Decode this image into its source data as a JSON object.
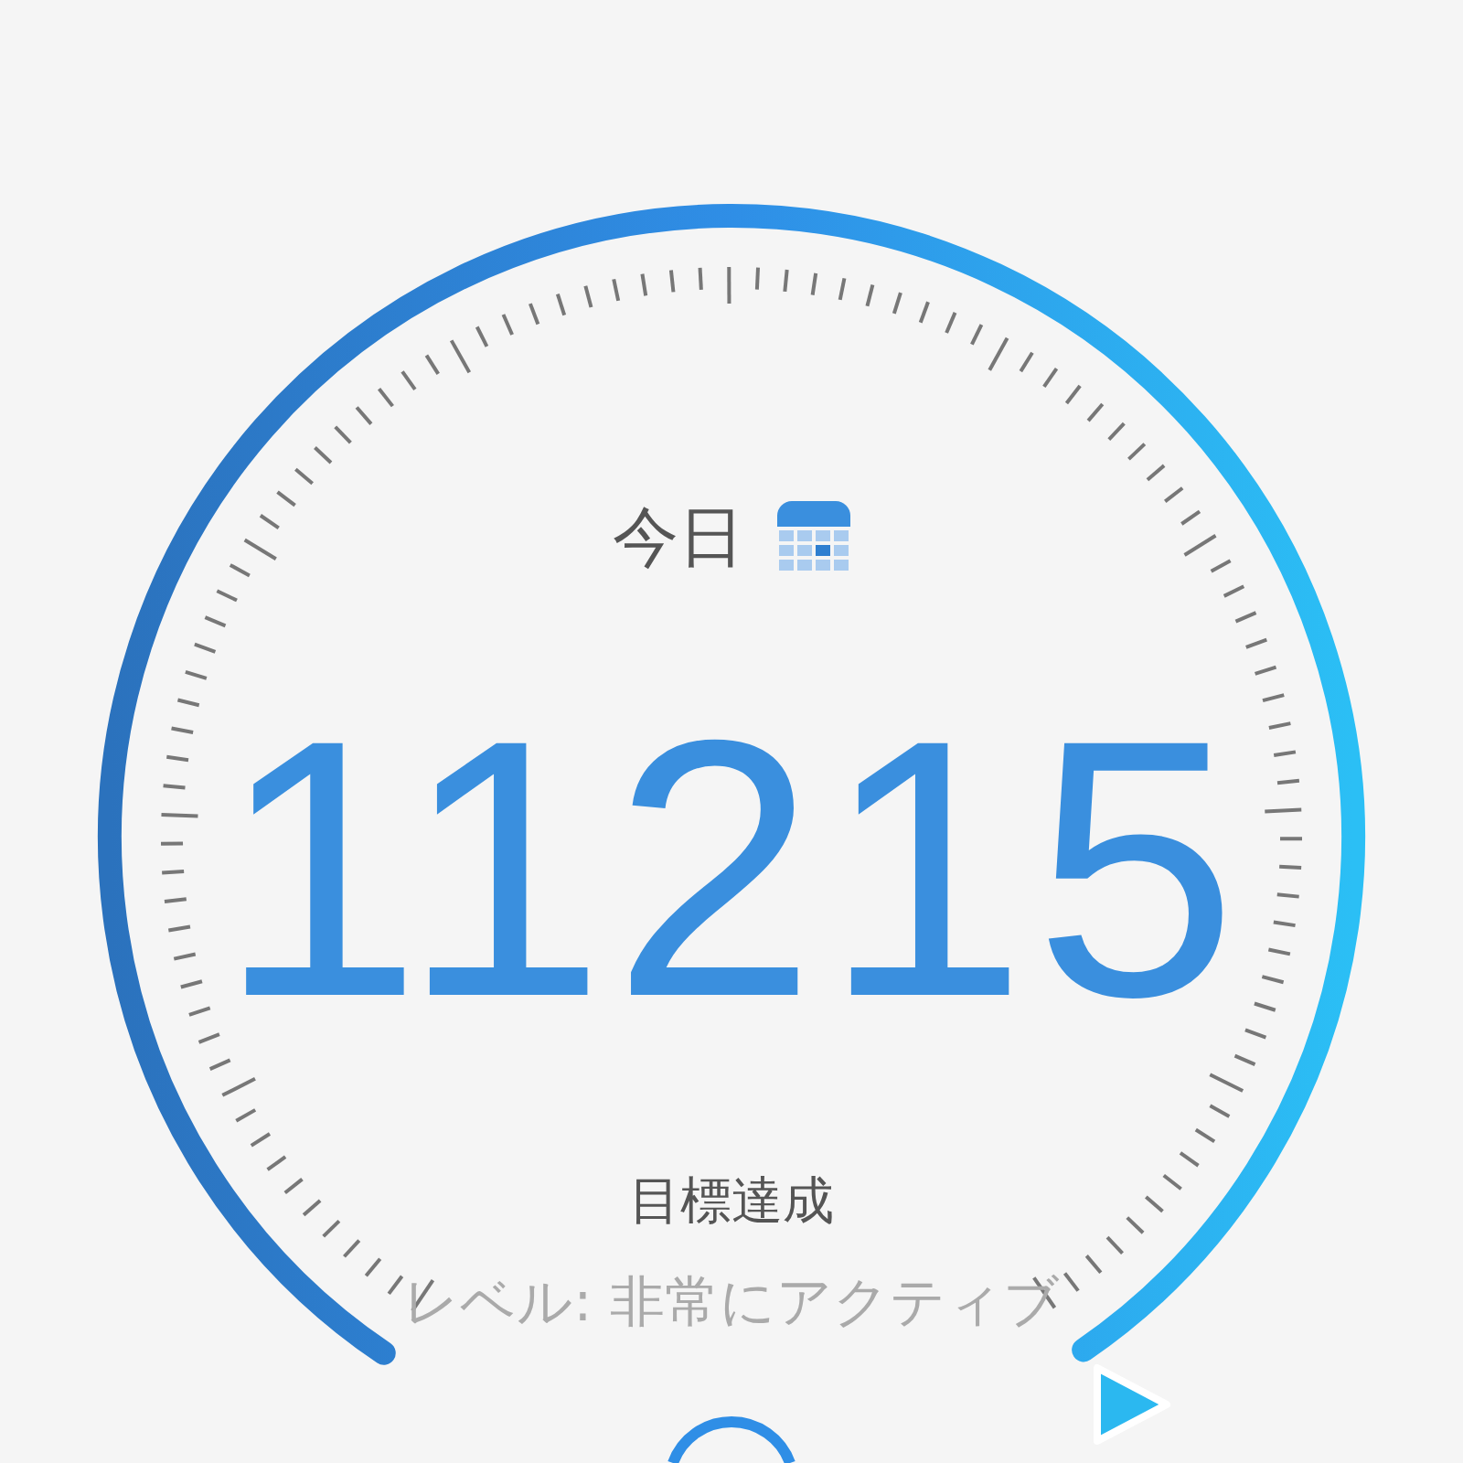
{
  "date_label": "今日",
  "steps": "11215",
  "goal_status": "目標達成",
  "activity_level": "レベル: 非常にアクティブ"
}
